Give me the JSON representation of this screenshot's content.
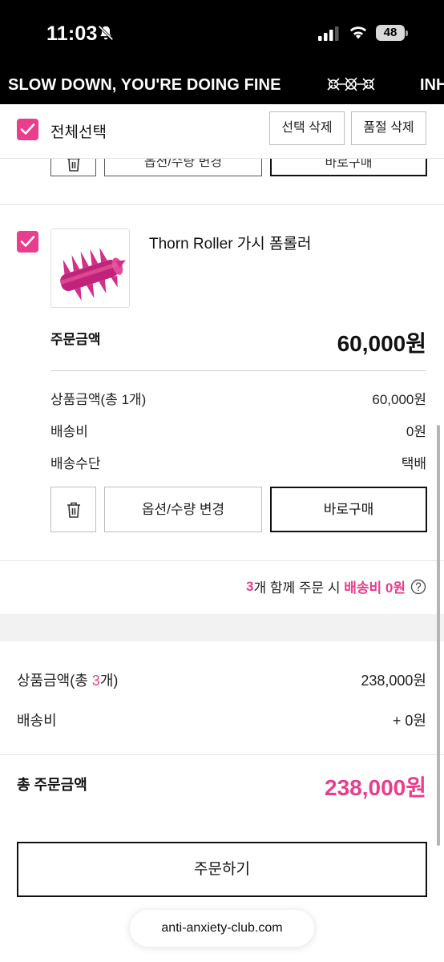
{
  "status_bar": {
    "time": "11:03",
    "battery": "48",
    "icons": [
      "bell-slash-icon",
      "cellular-signal-icon",
      "wifi-icon",
      "battery-icon"
    ]
  },
  "marquee": {
    "text": "SLOW DOWN, YOU'RE DOING FINE",
    "text_next": "INH",
    "logo": "brand-logo"
  },
  "header": {
    "select_all_label": "전체선택",
    "delete_selected_label": "선택 삭제",
    "delete_soldout_label": "품절 삭제"
  },
  "previous_item": {
    "option_label": "옵션/수량 변경",
    "buy_now_label": "바로구매"
  },
  "item": {
    "name": "Thorn Roller 가시 폼롤러",
    "order_amount_label": "주문금액",
    "order_amount": "60,000원",
    "product_amount_label": "상품금액(총 1개)",
    "product_amount": "60,000원",
    "shipping_label": "배송비",
    "shipping": "0원",
    "delivery_method_label": "배송수단",
    "delivery_method": "택배",
    "option_label": "옵션/수량 변경",
    "buy_now_label": "바로구매"
  },
  "bundle_notice": {
    "count": "3",
    "middle": "개 함께 주문 시 ",
    "highlight": "배송비 0원"
  },
  "totals": {
    "product_label_prefix": "상품금액(총 ",
    "product_count": "3",
    "product_label_suffix": "개)",
    "product_total": "238,000원",
    "shipping_label": "배송비",
    "shipping_total": "+ 0원",
    "grand_label": "총 주문금액",
    "grand_total": "238,000원"
  },
  "order_button_label": "주문하기",
  "browser": {
    "url": "anti-anxiety-club.com"
  },
  "colors": {
    "accent": "#e83e8c",
    "dark": "#111111",
    "band": "#f2f2f2"
  }
}
